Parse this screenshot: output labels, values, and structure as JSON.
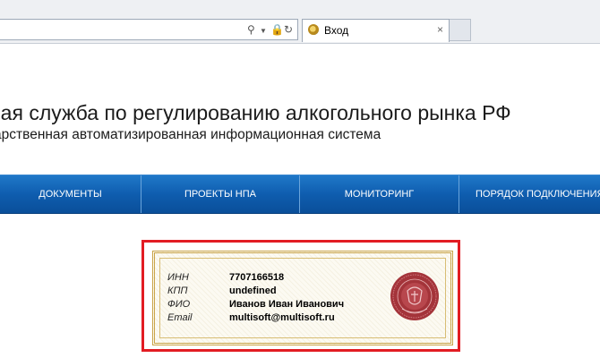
{
  "browser": {
    "tab_title": "Вход",
    "tab_close": "×",
    "icons": [
      "search-icon",
      "dropdown-icon",
      "lock-icon",
      "refresh-icon"
    ]
  },
  "header": {
    "title": "ьная служба по регулированию алкогольного рынка РФ",
    "subtitle": "дарственная автоматизированная информационная система"
  },
  "nav": {
    "items": [
      {
        "label": "ДОКУМЕНТЫ"
      },
      {
        "label": "ПРОЕКТЫ НПА"
      },
      {
        "label": "МОНИТОРИНГ"
      },
      {
        "label": "ПОРЯДОК ПОДКЛЮЧЕНИЯ"
      }
    ],
    "color": "#0f5daf"
  },
  "certificate": {
    "rows": [
      {
        "label": "ИНН",
        "value": "7707166518"
      },
      {
        "label": "КПП",
        "value": "undefined"
      },
      {
        "label": "ФИО",
        "value": "Иванов Иван Иванович"
      },
      {
        "label": "Email",
        "value": "multisoft@multisoft.ru"
      }
    ],
    "highlight_color": "#e21c23"
  }
}
